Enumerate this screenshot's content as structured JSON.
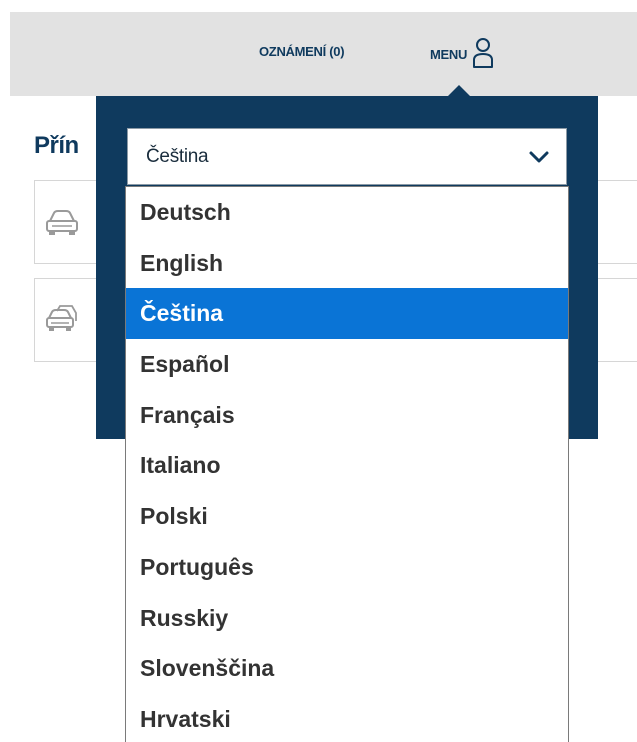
{
  "header": {
    "notifications_label": "OZNÁMENÍ (0)",
    "menu_label": "MENU",
    "menu_icon": "user-icon"
  },
  "page": {
    "heading": "Přín",
    "cards": [
      {
        "icon": "car-icon"
      },
      {
        "icon": "cars-icon"
      }
    ]
  },
  "language_select": {
    "value": "Čeština",
    "icon": "chevron-down-icon",
    "options": [
      "Deutsch",
      "English",
      "Čeština",
      "Español",
      "Français",
      "Italiano",
      "Polski",
      "Português",
      "Russkiy",
      "Slovenščina",
      "Hrvatski"
    ],
    "selected_index": 2
  },
  "colors": {
    "brand_navy": "#0f3a5e",
    "topbar_gray": "#e2e2e2",
    "selected_highlight": "#0a74d6",
    "option_text": "#333333"
  }
}
